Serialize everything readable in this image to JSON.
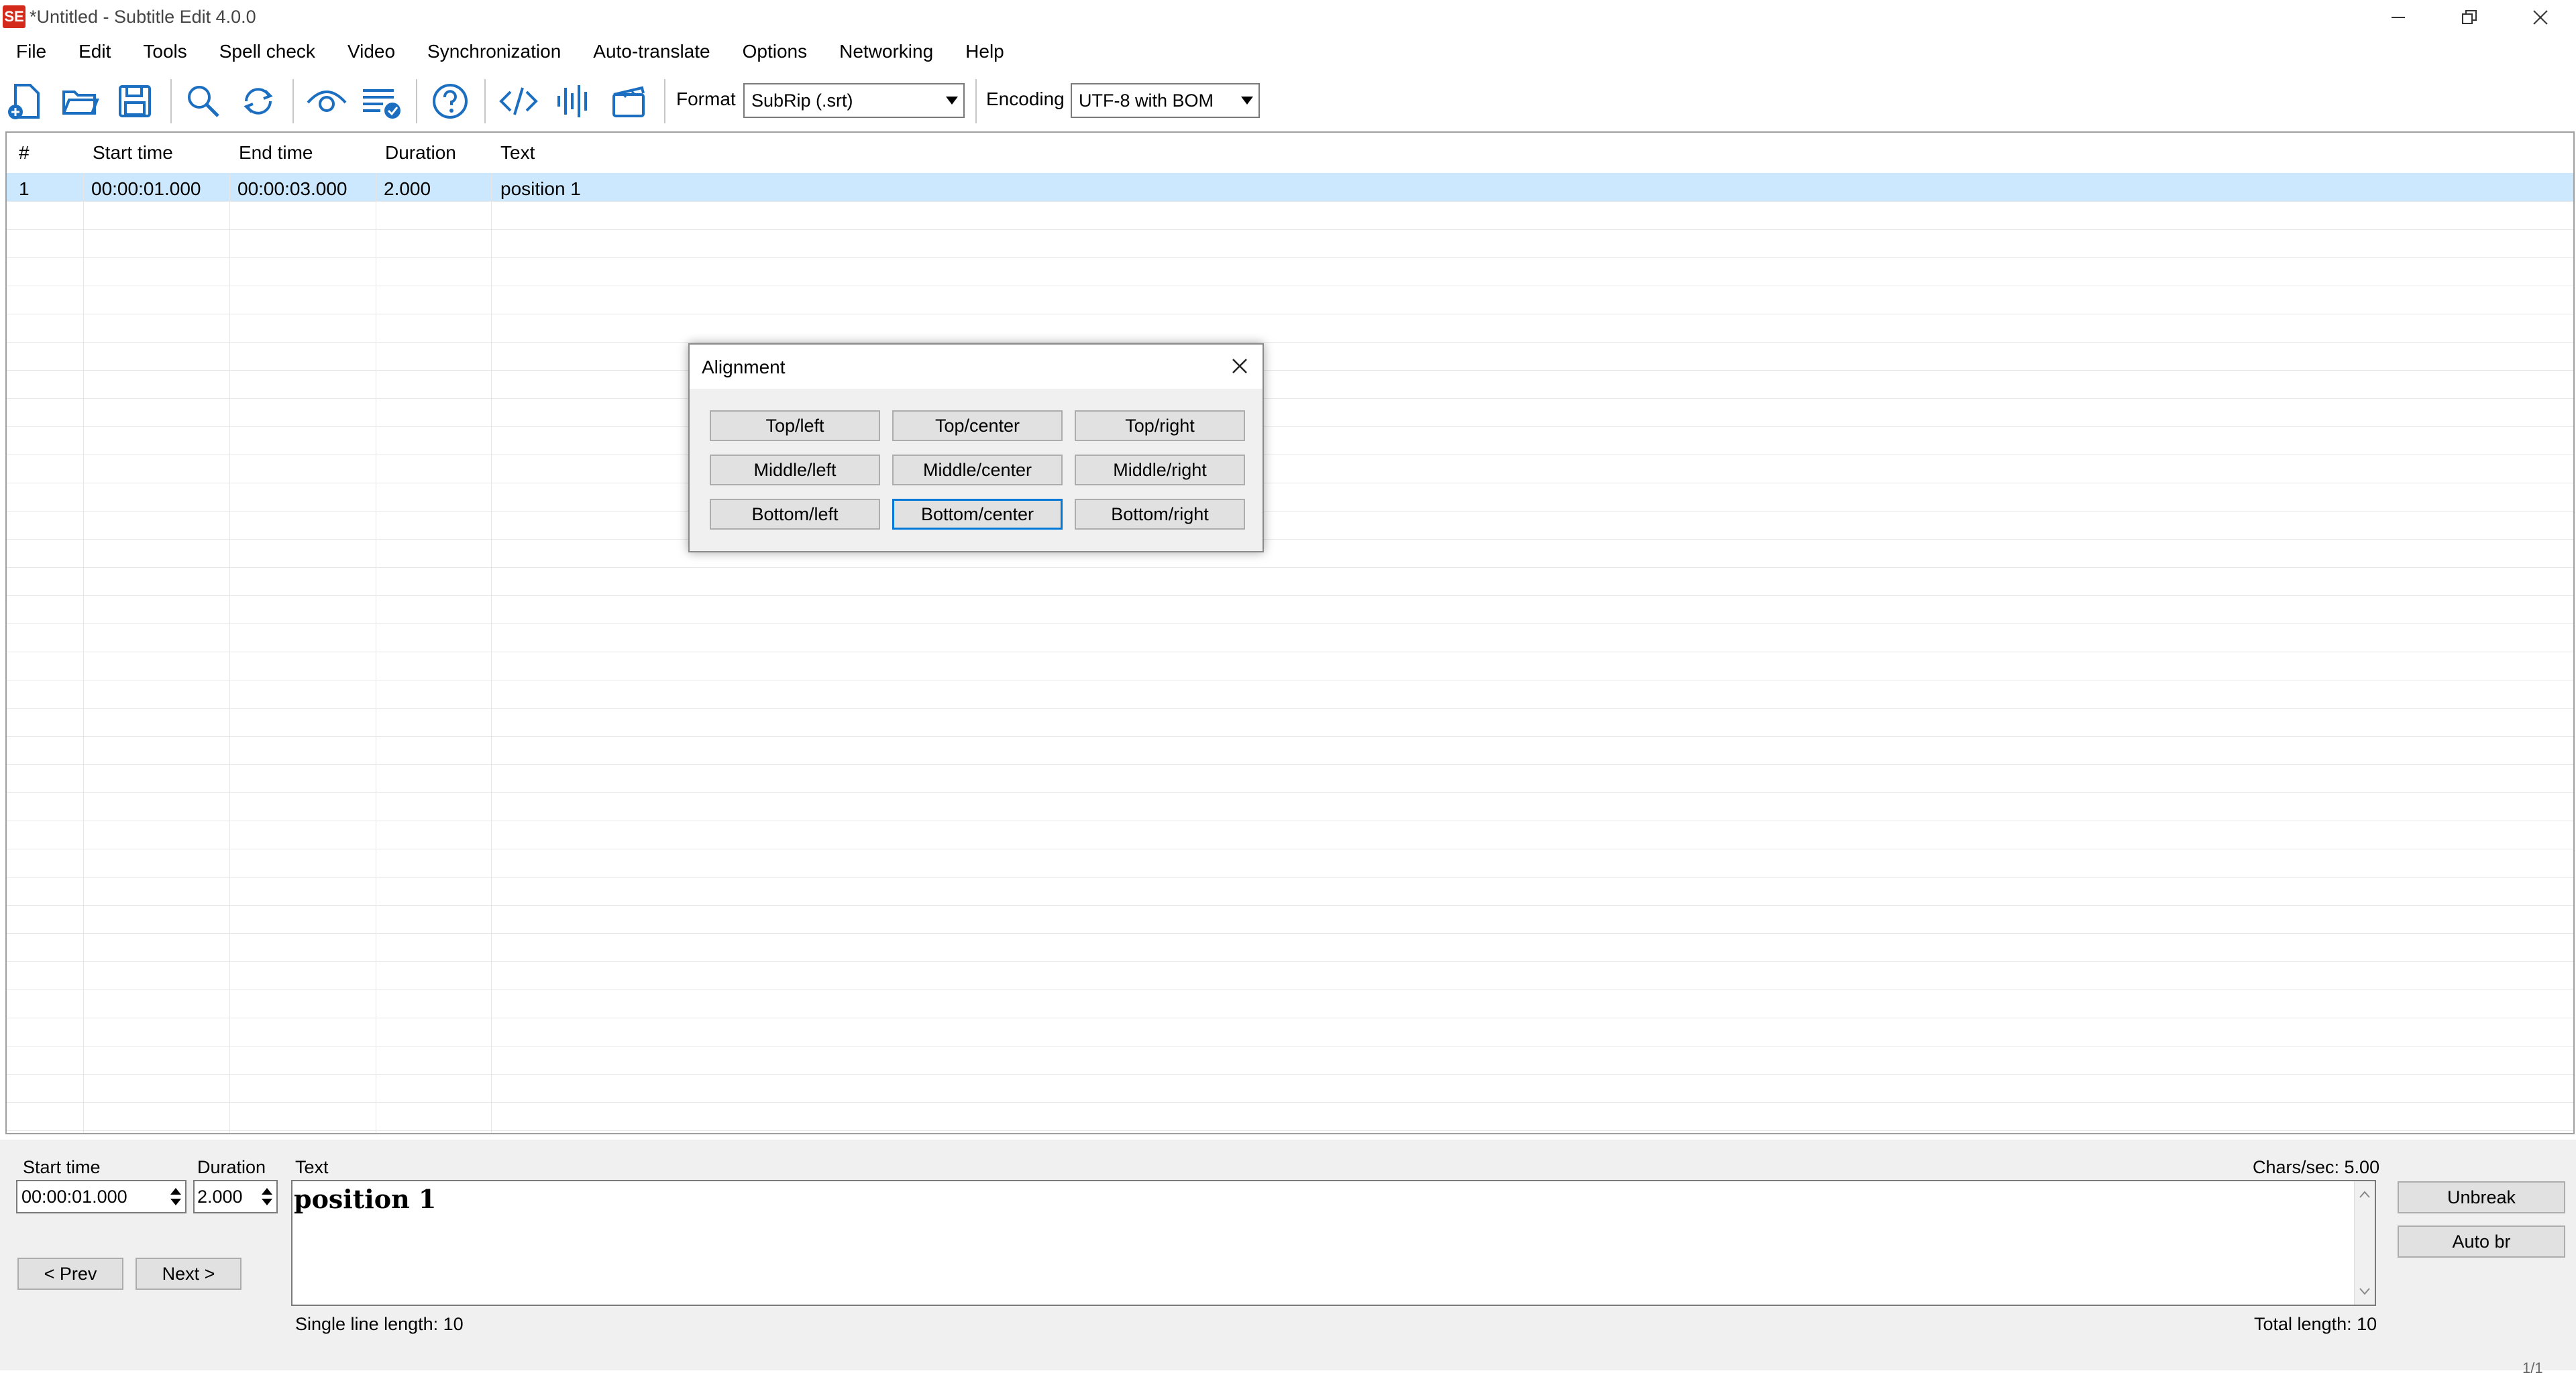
{
  "window": {
    "title": "*Untitled - Subtitle Edit 4.0.0",
    "app_icon_text": "SE"
  },
  "menu": [
    "File",
    "Edit",
    "Tools",
    "Spell check",
    "Video",
    "Synchronization",
    "Auto-translate",
    "Options",
    "Networking",
    "Help"
  ],
  "toolbar": {
    "format_label": "Format",
    "format_value": "SubRip (.srt)",
    "encoding_label": "Encoding",
    "encoding_value": "UTF-8 with BOM",
    "icons": [
      "new-file-icon",
      "open-folder-icon",
      "save-icon",
      "find-icon",
      "replace-icon",
      "visual-sync-icon",
      "spell-check-icon",
      "help-icon",
      "source-view-icon",
      "waveform-icon",
      "video-icon"
    ]
  },
  "grid": {
    "columns": [
      "#",
      "Start time",
      "End time",
      "Duration",
      "Text"
    ],
    "rows": [
      {
        "num": "1",
        "start": "00:00:01.000",
        "end": "00:00:03.000",
        "duration": "2.000",
        "text": "position 1"
      }
    ]
  },
  "dialog": {
    "title": "Alignment",
    "buttons": [
      [
        "Top/left",
        "Top/center",
        "Top/right"
      ],
      [
        "Middle/left",
        "Middle/center",
        "Middle/right"
      ],
      [
        "Bottom/left",
        "Bottom/center",
        "Bottom/right"
      ]
    ],
    "focused": "Bottom/center"
  },
  "editor": {
    "start_time_label": "Start time",
    "start_time_value": "00:00:01.000",
    "duration_label": "Duration",
    "duration_value": "2.000",
    "text_label": "Text",
    "chars_sec": "Chars/sec: 5.00",
    "text_value": "position 1",
    "prev_label": "< Prev",
    "next_label": "Next >",
    "single_line_length": "Single line length: 10",
    "total_length": "Total length: 10",
    "unbreak_label": "Unbreak",
    "auto_br_label": "Auto br",
    "status_right": "1/1"
  },
  "colors": {
    "selection": "#cce8ff",
    "focus_border": "#0078d7",
    "app_icon": "#d42a1c",
    "toolbar_icon": "#1c6fc0"
  }
}
